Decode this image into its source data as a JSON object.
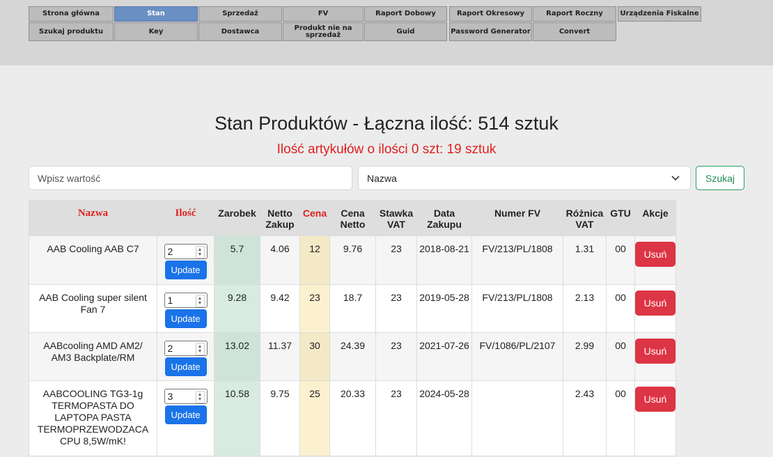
{
  "nav": {
    "row1": [
      "Strona główna",
      "Stan",
      "Sprzedaż",
      "FV",
      "Raport Dobowy",
      "Raport Okresowy",
      "Raport Roczny",
      "Urządzenia Fiskalne"
    ],
    "row2": [
      "Szukaj produktu",
      "Key",
      "Dostawca",
      "Produkt nie na sprzedaż",
      "Guid",
      "Password Generator",
      "Convert"
    ],
    "active": "Stan"
  },
  "page": {
    "title": "Stan Produktów - Łączna ilość: 514 sztuk",
    "subtitle": "Ilość artykułów o ilości 0 szt: 19 sztuk"
  },
  "search": {
    "placeholder": "Wpisz wartość",
    "field_selected": "Nazwa",
    "button_label": "Szukaj"
  },
  "table": {
    "headers": [
      "Nazwa",
      "Ilość",
      "Zarobek",
      "Netto Zakup",
      "Cena",
      "Cena Netto",
      "Stawka VAT",
      "Data Zakupu",
      "Numer FV",
      "Różnica VAT",
      "GTU",
      "Akcje"
    ],
    "update_label": "Update",
    "delete_label": "Usuń",
    "rows": [
      {
        "nazwa": "AAB Cooling AAB C7",
        "ilosc": "2",
        "zarobek": "5.7",
        "netto_zakup": "4.06",
        "cena": "12",
        "cena_netto": "9.76",
        "stawka_vat": "23",
        "data_zakupu": "2018-08-21",
        "numer_fv": "FV/213/PL/1808",
        "roznica_vat": "1.31",
        "gtu": "00"
      },
      {
        "nazwa": "AAB Cooling super silent Fan 7",
        "ilosc": "1",
        "zarobek": "9.28",
        "netto_zakup": "9.42",
        "cena": "23",
        "cena_netto": "18.7",
        "stawka_vat": "23",
        "data_zakupu": "2019-05-28",
        "numer_fv": "FV/213/PL/1808",
        "roznica_vat": "2.13",
        "gtu": "00"
      },
      {
        "nazwa": "AABcooling AMD AM2/ AM3 Backplate/RM",
        "ilosc": "2",
        "zarobek": "13.02",
        "netto_zakup": "11.37",
        "cena": "30",
        "cena_netto": "24.39",
        "stawka_vat": "23",
        "data_zakupu": "2021-07-26",
        "numer_fv": "FV/1086/PL/2107",
        "roznica_vat": "2.99",
        "gtu": "00"
      },
      {
        "nazwa": "AABCOOLING TG3-1g TERMOPASTA DO LAPTOPA PASTA TERMOPRZEWODZACA CPU 8,5W/mK!",
        "ilosc": "3",
        "zarobek": "10.58",
        "netto_zakup": "9.75",
        "cena": "25",
        "cena_netto": "20.33",
        "stawka_vat": "23",
        "data_zakupu": "2024-05-28",
        "numer_fv": "",
        "roznica_vat": "2.43",
        "gtu": "00"
      }
    ]
  },
  "colors": {
    "nav_active": "#6a8fc3",
    "accent_red": "#e02020",
    "update_blue": "#1a73e8",
    "delete_red": "#dc3545",
    "search_green": "#28a060"
  }
}
